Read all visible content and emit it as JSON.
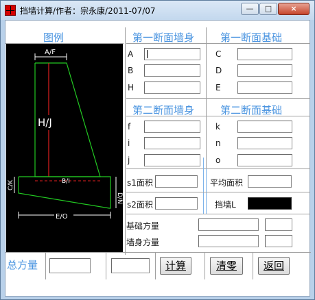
{
  "window": {
    "title": "挡墙计算/作者：宗永康/2011-07/07",
    "minimize": "—",
    "maximize": "□",
    "close": "×"
  },
  "legend": {
    "heading": "图例",
    "labels": {
      "top": "A/F",
      "height": "H/J",
      "base_inner": "B/I",
      "base_outer": "E/O",
      "left_side": "C/K",
      "right_side": "D/N"
    }
  },
  "section1": {
    "wall_heading": "第一断面墙身",
    "base_heading": "第一断面基础",
    "wall_fields": [
      {
        "label": "A",
        "value": ""
      },
      {
        "label": "B",
        "value": ""
      },
      {
        "label": "H",
        "value": ""
      }
    ],
    "base_fields": [
      {
        "label": "C",
        "value": ""
      },
      {
        "label": "D",
        "value": ""
      },
      {
        "label": "E",
        "value": ""
      }
    ]
  },
  "section2": {
    "wall_heading": "第二断面墙身",
    "base_heading": "第二断面基础",
    "wall_fields": [
      {
        "label": "f",
        "value": ""
      },
      {
        "label": "i",
        "value": ""
      },
      {
        "label": "j",
        "value": ""
      }
    ],
    "base_fields": [
      {
        "label": "k",
        "value": ""
      },
      {
        "label": "n",
        "value": ""
      },
      {
        "label": "o",
        "value": ""
      }
    ]
  },
  "areas": {
    "s1_label": "s1面积",
    "s2_label": "s2面积",
    "avg_label": "平均面积",
    "wall_len_label": "挡墙L",
    "s1_value": "",
    "s2_value": "",
    "avg_value": "",
    "wall_len_value": ""
  },
  "volume": {
    "base_label": "基础方量",
    "wall_label": "墙身方量",
    "base_value": "",
    "base_unit_value": "",
    "wall_value": "",
    "wall_unit_value": ""
  },
  "footer": {
    "total_label": "总方量",
    "total_value": "",
    "total_extra_value": "",
    "calc_button": "计算",
    "clear_button": "清零",
    "back_button": "返回"
  }
}
